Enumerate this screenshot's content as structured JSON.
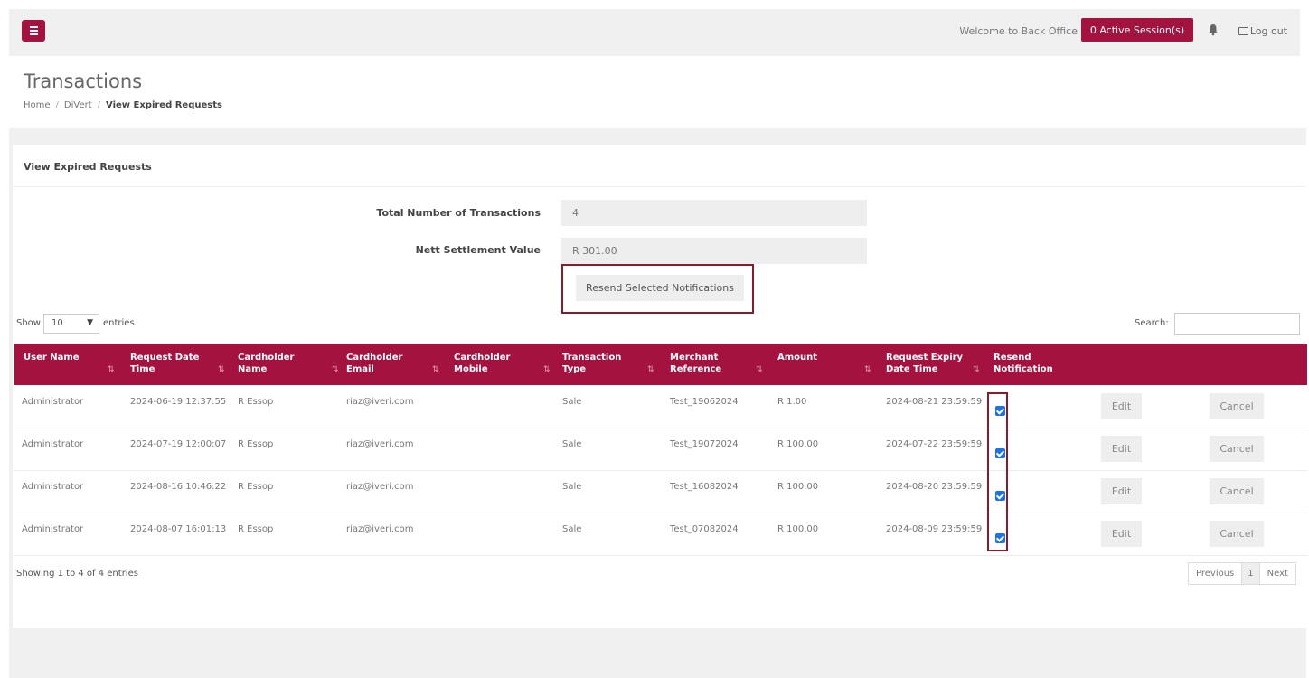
{
  "header": {
    "welcome": "Welcome to Back Office",
    "sessions_label": "0 Active Session(s)",
    "logout_label": "Log out"
  },
  "page": {
    "title": "Transactions",
    "breadcrumb": [
      "Home",
      "DiVert",
      "View Expired Requests"
    ]
  },
  "panel": {
    "title": "View Expired Requests",
    "summary": {
      "total_label": "Total Number of Transactions",
      "total_value": "4",
      "nett_label": "Nett Settlement Value",
      "nett_value": "R 301.00"
    },
    "resend_button": "Resend Selected Notifications"
  },
  "table_controls": {
    "show_label": "Show",
    "entries_value": "10",
    "entries_label": "entries",
    "search_label": "Search:"
  },
  "table": {
    "headers": [
      {
        "line1": "User Name",
        "line2": ""
      },
      {
        "line1": "Request Date",
        "line2": "Time"
      },
      {
        "line1": "Cardholder",
        "line2": "Name"
      },
      {
        "line1": "Cardholder",
        "line2": "Email"
      },
      {
        "line1": "Cardholder",
        "line2": "Mobile"
      },
      {
        "line1": "Transaction",
        "line2": "Type"
      },
      {
        "line1": "Merchant",
        "line2": "Reference"
      },
      {
        "line1": "Amount",
        "line2": ""
      },
      {
        "line1": "Request Expiry",
        "line2": "Date Time"
      },
      {
        "line1": "Resend",
        "line2": "Notification"
      }
    ],
    "rows": [
      {
        "user": "Administrator",
        "req_date": "2024-06-19 12:37:55",
        "name": "R Essop",
        "email": "riaz@iveri.com",
        "mobile": "",
        "type": "Sale",
        "ref": "Test_19062024",
        "amount": "R 1.00",
        "expiry": "2024-08-21 23:59:59",
        "checked": true,
        "edit": "Edit",
        "cancel": "Cancel"
      },
      {
        "user": "Administrator",
        "req_date": "2024-07-19 12:00:07",
        "name": "R Essop",
        "email": "riaz@iveri.com",
        "mobile": "",
        "type": "Sale",
        "ref": "Test_19072024",
        "amount": "R 100.00",
        "expiry": "2024-07-22 23:59:59",
        "checked": true,
        "edit": "Edit",
        "cancel": "Cancel"
      },
      {
        "user": "Administrator",
        "req_date": "2024-08-16 10:46:22",
        "name": "R Essop",
        "email": "riaz@iveri.com",
        "mobile": "",
        "type": "Sale",
        "ref": "Test_16082024",
        "amount": "R 100.00",
        "expiry": "2024-08-20 23:59:59",
        "checked": true,
        "edit": "Edit",
        "cancel": "Cancel"
      },
      {
        "user": "Administrator",
        "req_date": "2024-08-07 16:01:13",
        "name": "R Essop",
        "email": "riaz@iveri.com",
        "mobile": "",
        "type": "Sale",
        "ref": "Test_07082024",
        "amount": "R 100.00",
        "expiry": "2024-08-09 23:59:59",
        "checked": true,
        "edit": "Edit",
        "cancel": "Cancel"
      }
    ]
  },
  "footer": {
    "info": "Showing 1 to 4 of 4 entries",
    "prev": "Previous",
    "page": "1",
    "next": "Next"
  },
  "colors": {
    "brand": "#a4123f",
    "highlight": "#8b1a2b",
    "checkbox": "#1a73e8"
  }
}
